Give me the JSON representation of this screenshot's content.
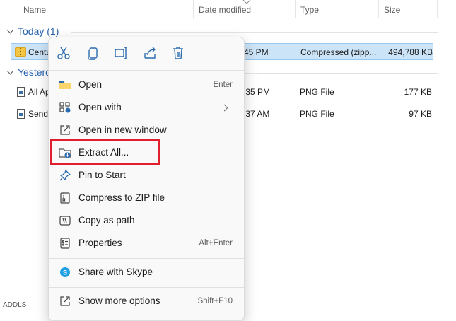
{
  "columns": {
    "name": "Name",
    "date_modified": "Date modified",
    "type": "Type",
    "size": "Size"
  },
  "groups": [
    {
      "label": "Today (1)"
    },
    {
      "label": "Yesterc"
    }
  ],
  "rows": [
    {
      "name": "Centu",
      "date": "45 PM",
      "type": "Compressed (zipp...",
      "size": "494,788 KB",
      "selected": true
    },
    {
      "name": "All Ap",
      "date": ":35 PM",
      "type": "PNG File",
      "size": "177 KB"
    },
    {
      "name": "Send",
      "date": ":37 AM",
      "type": "PNG File",
      "size": "97 KB"
    }
  ],
  "statusbar": {
    "text": "ADDLS"
  },
  "context_menu": {
    "quick_actions": [
      {
        "name": "cut-icon"
      },
      {
        "name": "copy-icon"
      },
      {
        "name": "rename-icon"
      },
      {
        "name": "share-icon"
      },
      {
        "name": "delete-icon"
      }
    ],
    "items": [
      {
        "label": "Open",
        "shortcut": "Enter",
        "icon": "folder-open-icon"
      },
      {
        "label": "Open with",
        "shortcut": "",
        "icon": "open-with-icon",
        "submenu": true
      },
      {
        "label": "Open in new window",
        "shortcut": "",
        "icon": "new-window-icon"
      },
      {
        "label": "Extract All...",
        "shortcut": "",
        "icon": "extract-icon"
      },
      {
        "label": "Pin to Start",
        "shortcut": "",
        "icon": "pin-icon"
      },
      {
        "label": "Compress to ZIP file",
        "shortcut": "",
        "icon": "zip-icon"
      },
      {
        "label": "Copy as path",
        "shortcut": "",
        "icon": "copy-path-icon"
      },
      {
        "label": "Properties",
        "shortcut": "Alt+Enter",
        "icon": "properties-icon"
      },
      {
        "label": "Share with Skype",
        "shortcut": "",
        "icon": "skype-icon"
      },
      {
        "label": "Show more options",
        "shortcut": "Shift+F10",
        "icon": "more-options-icon"
      }
    ]
  },
  "colors": {
    "accent": "#0067c0",
    "selection": "#cce4f7",
    "highlight_box": "#e0202e"
  }
}
